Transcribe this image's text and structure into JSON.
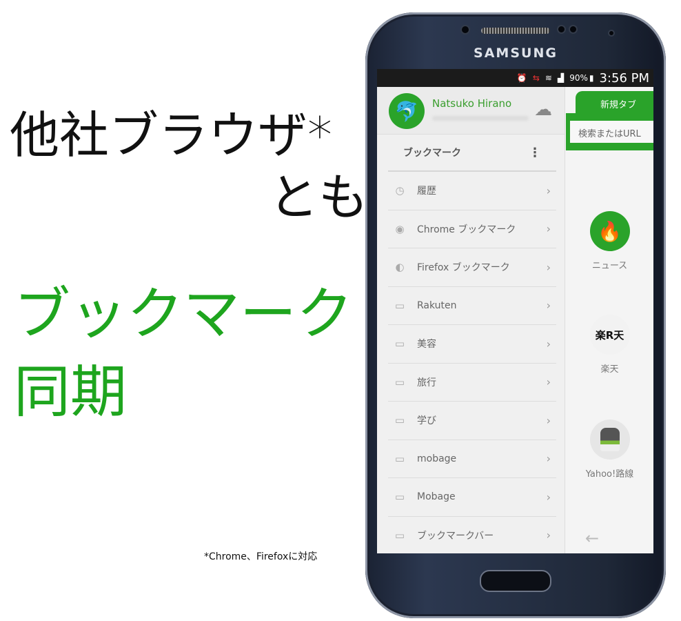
{
  "headline": {
    "line1": "他社ブラウザ*",
    "line2": "とも",
    "line3": "ブックマーク",
    "line4": "同期"
  },
  "footnote": "*Chrome、Firefoxに対応",
  "phone": {
    "brand": "SAMSUNG"
  },
  "status_bar": {
    "battery": "90%",
    "time": "3:56 PM",
    "icons": [
      "alarm-icon",
      "data-transfer-icon",
      "wifi-icon",
      "signal-icon",
      "battery-icon"
    ]
  },
  "drawer": {
    "user_name": "Natsuko Hirano",
    "section_title": "ブックマーク",
    "items": [
      {
        "label": "履歴",
        "icon": "clock-icon"
      },
      {
        "label": "Chrome ブックマーク",
        "icon": "chrome-icon"
      },
      {
        "label": "Firefox ブックマーク",
        "icon": "firefox-icon"
      },
      {
        "label": "Rakuten",
        "icon": "folder-icon"
      },
      {
        "label": "美容",
        "icon": "folder-icon"
      },
      {
        "label": "旅行",
        "icon": "folder-icon"
      },
      {
        "label": "学び",
        "icon": "folder-icon"
      },
      {
        "label": "mobage",
        "icon": "folder-icon"
      },
      {
        "label": "Mobage",
        "icon": "folder-icon"
      },
      {
        "label": "ブックマークバー",
        "icon": "folder-icon"
      }
    ]
  },
  "browser": {
    "tab_title": "新規タブ",
    "url_placeholder": "検索またはURL",
    "speed_dials": [
      {
        "label": "ニュース",
        "icon": "flame-icon"
      },
      {
        "label": "楽天",
        "logo": "楽R天"
      },
      {
        "label": "Yahoo!路線",
        "icon": "train-icon"
      }
    ]
  },
  "colors": {
    "accent": "#2aa32a",
    "headline_green": "#1ea51e"
  }
}
